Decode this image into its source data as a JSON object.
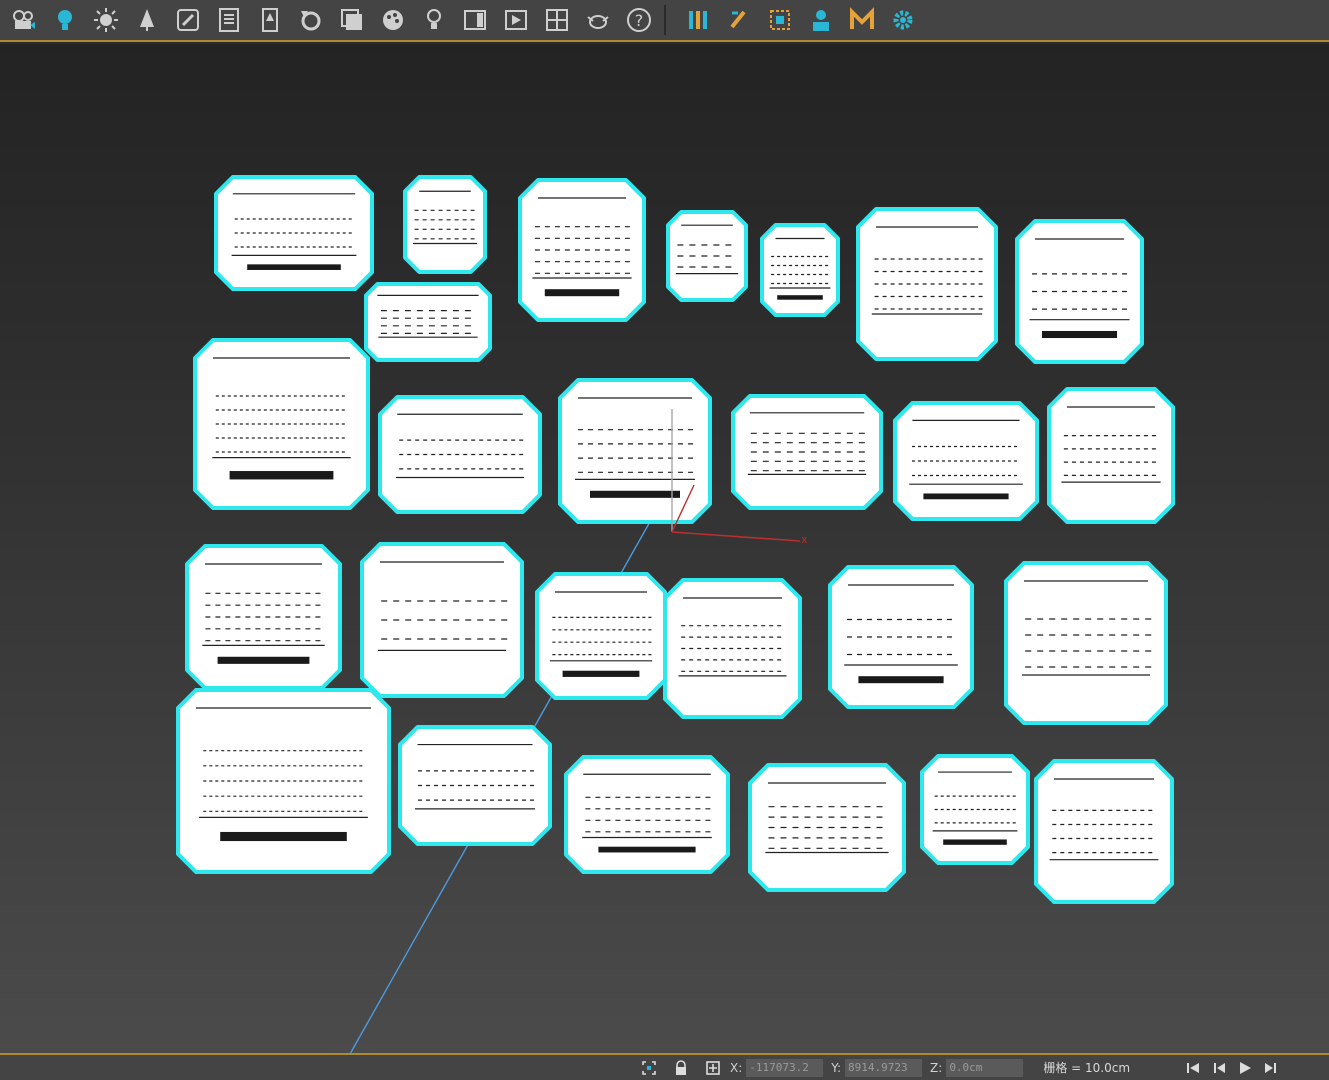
{
  "toolbar": {
    "items": [
      {
        "name": "render-setup-icon",
        "color": "#cfcfcf"
      },
      {
        "name": "light-bulb-icon",
        "color": "#2ab7d5"
      },
      {
        "name": "sun-icon",
        "color": "#cfcfcf"
      },
      {
        "name": "tree-icon",
        "color": "#cfcfcf"
      },
      {
        "name": "edit-image-icon",
        "color": "#cfcfcf"
      },
      {
        "name": "list-icon",
        "color": "#cfcfcf"
      },
      {
        "name": "figure-icon",
        "color": "#cfcfcf"
      },
      {
        "name": "rotate-icon",
        "color": "#cfcfcf"
      },
      {
        "name": "layers-icon",
        "color": "#cfcfcf"
      },
      {
        "name": "palette-icon",
        "color": "#cfcfcf"
      },
      {
        "name": "lamp-icon",
        "color": "#cfcfcf"
      },
      {
        "name": "window-icon",
        "color": "#cfcfcf"
      },
      {
        "name": "play-frame-icon",
        "color": "#cfcfcf"
      },
      {
        "name": "crosshair-icon",
        "color": "#cfcfcf"
      },
      {
        "name": "teapot-icon",
        "color": "#cfcfcf"
      },
      {
        "name": "help-icon",
        "color": "#cfcfcf"
      },
      {
        "name": "bars-icon",
        "color": "#2ab7d5"
      },
      {
        "name": "brush-icon",
        "color": "#e3a23a"
      },
      {
        "name": "select-region-icon",
        "color": "#e3a23a"
      },
      {
        "name": "person-icon",
        "color": "#2ab7d5"
      },
      {
        "name": "m-logo-icon",
        "color": "#e3a23a"
      },
      {
        "name": "gear-icon",
        "color": "#2ab7d5"
      }
    ]
  },
  "viewport": {
    "wire_color": "#ffffff",
    "selection_color": "#2ee8ee",
    "x_axis_label": "x"
  },
  "status": {
    "x_label": "X:",
    "x_value": "-117073.2",
    "y_label": "Y:",
    "y_value": "8914.9723",
    "z_label": "Z:",
    "z_value": "0.0cm",
    "grid_text": "栅格 = 10.0cm"
  }
}
